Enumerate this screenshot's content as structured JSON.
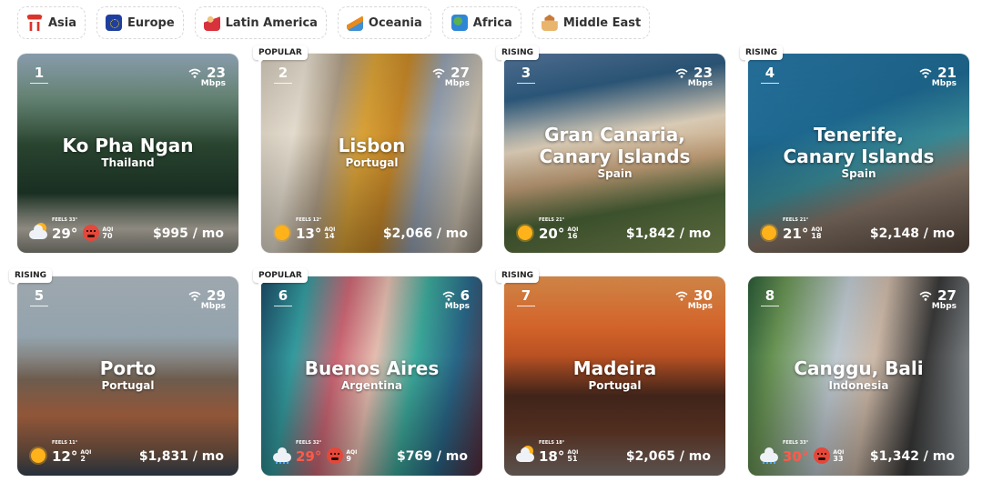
{
  "regions": [
    {
      "label": "Asia",
      "icon": "torii-gate-icon"
    },
    {
      "label": "Europe",
      "icon": "eu-flag-icon"
    },
    {
      "label": "Latin America",
      "icon": "dancer-icon"
    },
    {
      "label": "Oceania",
      "icon": "surfboard-icon"
    },
    {
      "label": "Africa",
      "icon": "globe-africa-icon"
    },
    {
      "label": "Middle East",
      "icon": "mosque-icon"
    }
  ],
  "cards": [
    {
      "rank": "1",
      "city": "Ko Pha Ngan",
      "country": "Thailand",
      "wifi": "23",
      "wifi_unit": "Mbps",
      "feels": "FEELS 33°",
      "temp": "29°",
      "aqi_label": "AQI",
      "aqi": "70",
      "price": "$995 / mo",
      "weather": "partly-cloudy-icon",
      "aqi_icon": "angry-face-icon",
      "badge": "",
      "hot": false
    },
    {
      "rank": "2",
      "city": "Lisbon",
      "country": "Portugal",
      "wifi": "27",
      "wifi_unit": "Mbps",
      "feels": "FEELS 12°",
      "temp": "13°",
      "aqi_label": "AQI",
      "aqi": "14",
      "price": "$2,066 / mo",
      "weather": "sun-icon",
      "aqi_icon": "",
      "badge": "POPULAR",
      "hot": false
    },
    {
      "rank": "3",
      "city": "Gran Canaria, Canary Islands",
      "country": "Spain",
      "wifi": "23",
      "wifi_unit": "Mbps",
      "feels": "FEELS 21°",
      "temp": "20°",
      "aqi_label": "AQI",
      "aqi": "16",
      "price": "$1,842 / mo",
      "weather": "sun-icon",
      "aqi_icon": "",
      "badge": "RISING",
      "hot": false
    },
    {
      "rank": "4",
      "city": "Tenerife, Canary Islands",
      "country": "Spain",
      "wifi": "21",
      "wifi_unit": "Mbps",
      "feels": "FEELS 21°",
      "temp": "21°",
      "aqi_label": "AQI",
      "aqi": "18",
      "price": "$2,148 / mo",
      "weather": "sun-icon",
      "aqi_icon": "",
      "badge": "RISING",
      "hot": false
    },
    {
      "rank": "5",
      "city": "Porto",
      "country": "Portugal",
      "wifi": "29",
      "wifi_unit": "Mbps",
      "feels": "FEELS 11°",
      "temp": "12°",
      "aqi_label": "AQI",
      "aqi": "2",
      "price": "$1,831 / mo",
      "weather": "sun-icon",
      "aqi_icon": "",
      "badge": "RISING",
      "hot": false
    },
    {
      "rank": "6",
      "city": "Buenos Aires",
      "country": "Argentina",
      "wifi": "6",
      "wifi_unit": "Mbps",
      "feels": "FEELS 32°",
      "temp": "29°",
      "aqi_label": "AQI",
      "aqi": "9",
      "price": "$769 / mo",
      "weather": "rain-icon",
      "aqi_icon": "angry-face-icon",
      "badge": "POPULAR",
      "hot": true
    },
    {
      "rank": "7",
      "city": "Madeira",
      "country": "Portugal",
      "wifi": "30",
      "wifi_unit": "Mbps",
      "feels": "FEELS 18°",
      "temp": "18°",
      "aqi_label": "AQI",
      "aqi": "51",
      "price": "$2,065 / mo",
      "weather": "partly-cloudy-icon",
      "aqi_icon": "",
      "badge": "RISING",
      "hot": false
    },
    {
      "rank": "8",
      "city": "Canggu, Bali",
      "country": "Indonesia",
      "wifi": "27",
      "wifi_unit": "Mbps",
      "feels": "FEELS 33°",
      "temp": "30°",
      "aqi_label": "AQI",
      "aqi": "33",
      "price": "$1,342 / mo",
      "weather": "rain-icon",
      "aqi_icon": "angry-face-icon",
      "badge": "",
      "hot": true
    }
  ]
}
